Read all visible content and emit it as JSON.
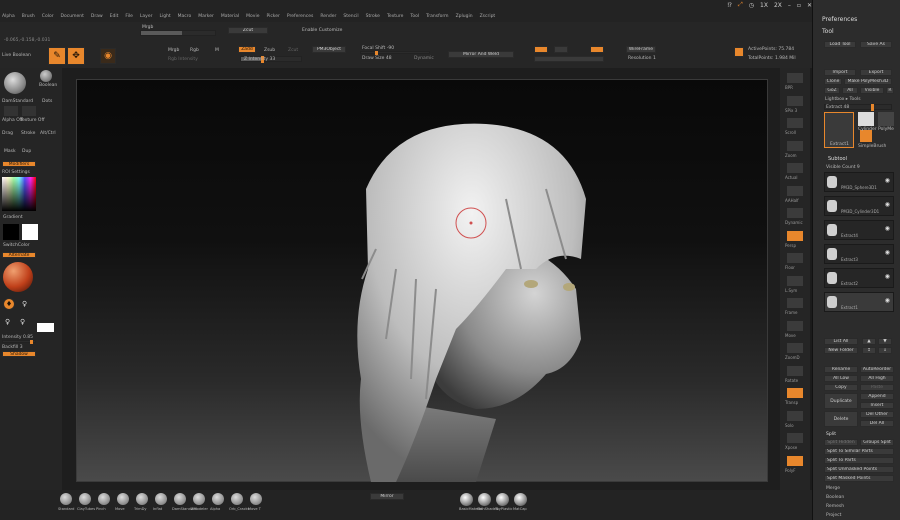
{
  "menu": [
    "Alpha",
    "Brush",
    "Color",
    "Document",
    "Draw",
    "Edit",
    "File",
    "Layer",
    "Light",
    "Macro",
    "Marker",
    "Material",
    "Movie",
    "Picker",
    "Preferences",
    "Render",
    "Stencil",
    "Stroke",
    "Texture",
    "Tool",
    "Transform",
    "Zplugin",
    "Zscript"
  ],
  "topright": {
    "x1": "1X",
    "x2": "2X",
    "prefs": "Preferences",
    "tool": "Tool"
  },
  "toolbar": {
    "coords": "-0.065,-0.158,-0.031",
    "lightbox": "Live Boolean",
    "edit": "Edit",
    "draw": "Draw",
    "zintensity": "Z Intensity 33",
    "focal": "Focal Shift -90",
    "draw_size": "Draw Size 48",
    "dynamic": "Dynamic",
    "mrgb": "Mrgb",
    "rgb": "Rgb",
    "m": "M",
    "zadd": "Zadd",
    "zsub": "Zsub",
    "zcut": "Zcut",
    "rgb_intensity": "Rgb Intensity",
    "pm3d": "PM3Object",
    "mirror": "Mirror And Weld",
    "active_points": "ActivePoints: 75.784",
    "total_points": "TotalPoints: 1.984 Mil",
    "wireframe": "WireFrame",
    "resolution": "Resolution 1",
    "infinite": "Infinite",
    "enable": "Enable Customize"
  },
  "left": {
    "brush": "DamStandard",
    "boolean": "Boolean",
    "alpha": "Alpha Off",
    "texture": "Texture Off",
    "dots": "Dots",
    "drag": "Drag",
    "stroke": "Stroke",
    "lazy": "Alt/Ctrl",
    "mask": "Mask",
    "dup": "Dup",
    "gradient": "Gradient",
    "switch": "SwitchColor",
    "alternate": "Alternate",
    "intensity": "Intensity 0.85",
    "radius": "Backfill 3",
    "shadow": "Shadow",
    "lock": "Modifiers",
    "rc": "ROI Settings"
  },
  "right_shelf": [
    "BPR",
    "SPix 3",
    "Scroll",
    "Zoom",
    "Actual",
    "AAHalf",
    "Dynamic",
    "Persp",
    "Floor",
    "L.Sym",
    "Frame",
    "Move",
    "ZoomD",
    "Rotate",
    "Transp",
    "Solo",
    "Xpose",
    "PolyF"
  ],
  "tool": {
    "load": "Load Tool",
    "save": "Save As",
    "import": "Import",
    "export": "Export",
    "clone": "Clone",
    "make": "Make PolyMesh3D",
    "goz": "GoZ",
    "all": "All",
    "visible": "Visible",
    "r": "R",
    "lightbox": "Lightbox ▸ Tools",
    "extract_val": "Extract 48",
    "thumbs": [
      "Extract2",
      "Cylinder PolyMe",
      "SimpleBrush",
      "Extract1"
    ],
    "subtool": "Subtool",
    "visible_count": "Visible Count 9",
    "subtools": [
      "PM3D_Sphere3D1",
      "PM3D_Cylinder3D1",
      "Extract4",
      "Extract3",
      "Extract2",
      "Extract1"
    ],
    "list_all": "List All",
    "new_folder": "New Folder",
    "rename": "Rename",
    "autoreorder": "AutoReorder",
    "all_low": "All Low",
    "all_high": "All High",
    "copy": "Copy",
    "paste": "Paste",
    "duplicate": "Duplicate",
    "append": "Append",
    "insert": "Insert",
    "delete": "Delete",
    "del_other": "Del Other",
    "del_all": "Del All",
    "split": "Split",
    "split_hidden": "Split Hidden",
    "groups_split": "Groups Split",
    "split_similar": "Split To Similar Parts",
    "split_parts": "Split To Parts",
    "split_unmasked": "Split Unmasked Points",
    "split_masked": "Split Masked Points",
    "merge": "Merge",
    "boolean": "Boolean",
    "remesh": "Remesh",
    "project": "Project"
  },
  "bottom": {
    "brushes": [
      "Standard",
      "ClayTubes",
      "Pinch",
      "Move",
      "TrimDy",
      "Inflat",
      "DamStandard",
      "ZModeler",
      "Alpha",
      "Orb_Cracks",
      "Move T"
    ],
    "mid_label": "Mirror",
    "mats": [
      "BasicMaterial",
      "SkinShade4",
      "ToyPlastic",
      "MatCap"
    ]
  },
  "colors": {
    "accent": "#e8872c",
    "panel": "#2e2e2e",
    "bg": "#1b1b1b"
  }
}
